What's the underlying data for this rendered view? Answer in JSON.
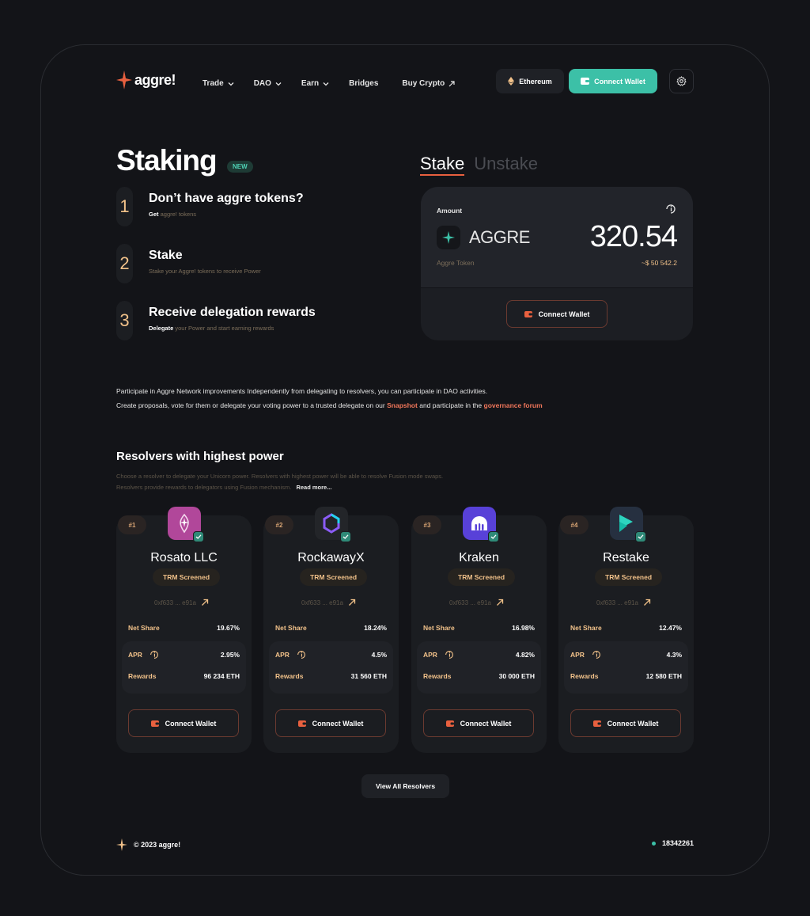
{
  "brand": {
    "name": "aggre!",
    "accent": "#e8603f",
    "teal": "#3cc0a7"
  },
  "nav": {
    "items": [
      {
        "label": "Trade",
        "dropdown": true
      },
      {
        "label": "DAO",
        "dropdown": true
      },
      {
        "label": "Earn",
        "dropdown": true
      },
      {
        "label": "Bridges",
        "dropdown": false
      },
      {
        "label": "Buy Crypto",
        "external": true
      }
    ],
    "network": "Ethereum",
    "connect_wallet": "Connect Wallet"
  },
  "staking": {
    "title": "Staking",
    "badge": "NEW",
    "steps": [
      {
        "num": "1",
        "title": "Don’t have aggre tokens?",
        "sub_bold": "Get",
        "sub": "aggre! tokens"
      },
      {
        "num": "2",
        "title": "Stake",
        "sub_bold": "",
        "sub": "Stake your Aggre! tokens to receive Power"
      },
      {
        "num": "3",
        "title": "Receive delegation rewards",
        "sub_bold": "Delegate",
        "sub": "your Power and start earning rewards"
      }
    ],
    "tabs": {
      "active": "Stake",
      "inactive": "Unstake"
    },
    "card": {
      "amount_label": "Amount",
      "token": "AGGRE",
      "token_sub": "Aggre Token",
      "amount": "320.54",
      "usd": "~$ 50 542.2",
      "button": "Connect Wallet"
    }
  },
  "info": {
    "line1": "Participate in Aggre Network improvements Independently from delegating to resolvers, you can participate in DAO activities.",
    "line2_a": "Create proposals, vote for them or delegate your voting power to a trusted delegate on our",
    "line2_link1": "Snapshot",
    "line2_b": "and participate in the",
    "line2_link2": "governance forum"
  },
  "resolvers": {
    "title": "Resolvers with highest power",
    "desc1": "Choose a resolver to delegate your Unicorn power. Resolvers with highest power will be able to resolve Fusion mode swaps.",
    "desc2": "Resolvers provide rewards to delegators using Fusion mechanism.",
    "read_more": "Read more...",
    "labels": {
      "net_share": "Net Share",
      "apr": "APR",
      "rewards": "Rewards",
      "screened": "TRM Screened",
      "button": "Connect Wallet"
    },
    "items": [
      {
        "rank": "#1",
        "name": "Rosato LLC",
        "address": "0xf633 ... e91a",
        "net_share": "19.67%",
        "apr": "2.95%",
        "rewards": "96 234 ETH",
        "logo_color": "#b1479a"
      },
      {
        "rank": "#2",
        "name": "RockawayX",
        "address": "0xf633 ... e91a",
        "net_share": "18.24%",
        "apr": "4.5%",
        "rewards": "31 560 ETH",
        "logo_color": "#232529"
      },
      {
        "rank": "#3",
        "name": "Kraken",
        "address": "0xf633 ... e91a",
        "net_share": "16.98%",
        "apr": "4.82%",
        "rewards": "30 000 ETH",
        "logo_color": "#5841d8"
      },
      {
        "rank": "#4",
        "name": "Restake",
        "address": "0xf633 ... e91a",
        "net_share": "12.47%",
        "apr": "4.3%",
        "rewards": "12 580 ETH",
        "logo_color": "#263040"
      }
    ],
    "view_all": "View All Resolvers"
  },
  "footer": {
    "copyright": "© 2023 aggre!",
    "block": "18342261"
  }
}
